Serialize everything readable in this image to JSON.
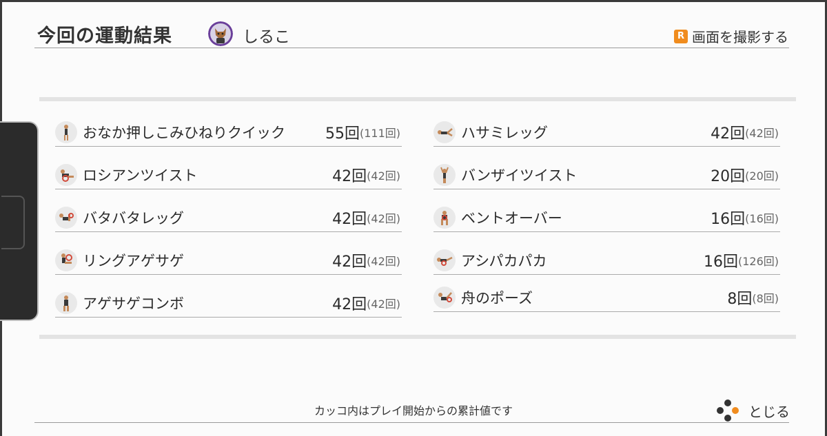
{
  "header": {
    "title": "今回の運動結果",
    "username": "しるこ",
    "screenshot_badge": "R",
    "screenshot_label": "画面を撮影する"
  },
  "exercises_left": [
    {
      "name": "おなか押しこみひねりクイック",
      "count": "55回",
      "total": "(111回)"
    },
    {
      "name": "ロシアンツイスト",
      "count": "42回",
      "total": "(42回)"
    },
    {
      "name": "バタバタレッグ",
      "count": "42回",
      "total": "(42回)"
    },
    {
      "name": "リングアゲサゲ",
      "count": "42回",
      "total": "(42回)"
    },
    {
      "name": "アゲサゲコンボ",
      "count": "42回",
      "total": "(42回)"
    }
  ],
  "exercises_right": [
    {
      "name": "ハサミレッグ",
      "count": "42回",
      "total": "(42回)"
    },
    {
      "name": "バンザイツイスト",
      "count": "20回",
      "total": "(20回)"
    },
    {
      "name": "ベントオーバー",
      "count": "16回",
      "total": "(16回)"
    },
    {
      "name": "アシパカパカ",
      "count": "16回",
      "total": "(126回)"
    },
    {
      "name": "舟のポーズ",
      "count": "8回",
      "total": "(8回)"
    }
  ],
  "footer": {
    "note": "カッコ内はプレイ開始からの累計値です",
    "close_label": "とじる",
    "close_icon": "button-cluster-icon"
  },
  "colors": {
    "accent": "#f08c1e",
    "text": "#2b2b2b",
    "band": "#e3e3e3"
  }
}
